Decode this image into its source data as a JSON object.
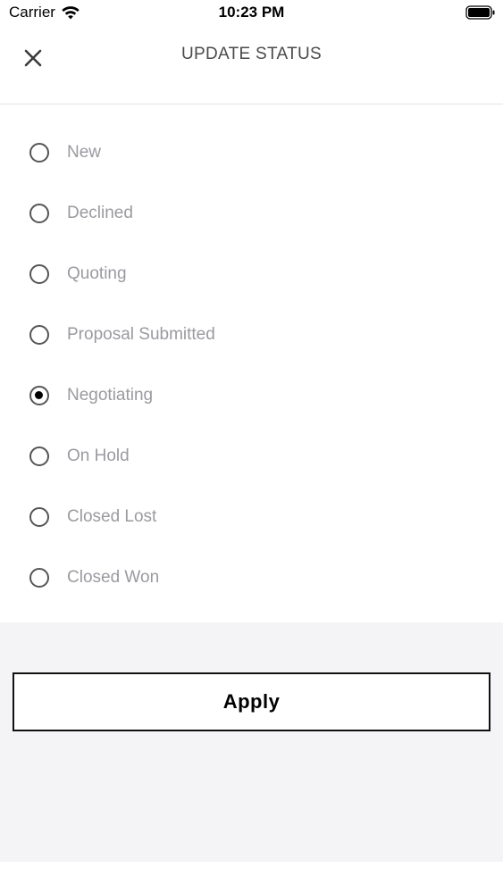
{
  "status_bar": {
    "carrier": "Carrier",
    "time": "10:23 PM"
  },
  "header": {
    "title": "UPDATE STATUS",
    "close_icon": "close-icon"
  },
  "options": [
    {
      "label": "New",
      "selected": false
    },
    {
      "label": "Declined",
      "selected": false
    },
    {
      "label": "Quoting",
      "selected": false
    },
    {
      "label": "Proposal Submitted",
      "selected": false
    },
    {
      "label": "Negotiating",
      "selected": true
    },
    {
      "label": "On Hold",
      "selected": false
    },
    {
      "label": "Closed Lost",
      "selected": false
    },
    {
      "label": "Closed Won",
      "selected": false
    }
  ],
  "footer": {
    "apply_label": "Apply"
  },
  "colors": {
    "footer_bg": "#f4f3f6",
    "label_text": "#9a9aa0",
    "title_text": "#4a4a4a"
  }
}
